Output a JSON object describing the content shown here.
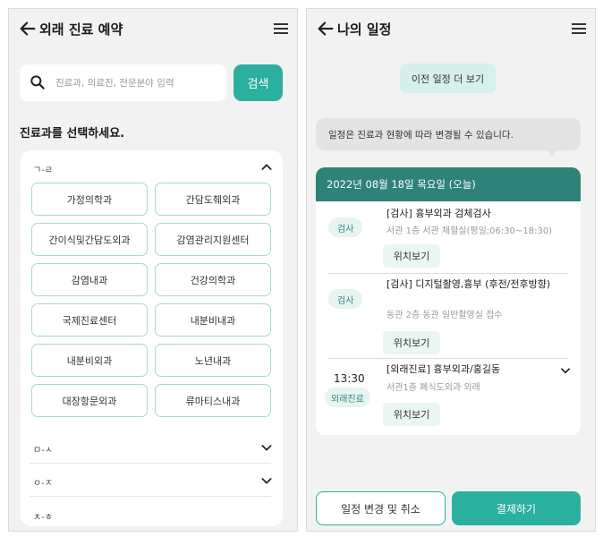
{
  "left_screen": {
    "header": {
      "title": "외래 진료 예약"
    },
    "search": {
      "placeholder": "진료과, 의료진, 전문분야 입력",
      "button_label": "검색"
    },
    "section_label": "진료과를 선택하세요.",
    "groups": [
      {
        "name": "ㄱ-ㄹ",
        "expanded": true,
        "departments": [
          "가정의학과",
          "간담도췌외과",
          "간이식및간담도외과",
          "감염관리지원센터",
          "감염내과",
          "건강의학과",
          "국제진료센터",
          "내분비내과",
          "내분비외과",
          "노년내과",
          "대장항문외과",
          "류마티스내과"
        ]
      },
      {
        "name": "ㅁ-ㅅ",
        "expanded": false
      },
      {
        "name": "ㅇ-ㅈ",
        "expanded": false
      },
      {
        "name": "ㅊ-ㅎ",
        "expanded": false
      }
    ]
  },
  "right_screen": {
    "header": {
      "title": "나의 일정"
    },
    "prev_button": "이전 일정 더 보기",
    "notice": "일정은 진료과 현황에 따라 변경될 수 있습니다.",
    "date_header": "2022년 08월 18일 목요일 (오늘)",
    "entries": [
      {
        "tag": "검사",
        "title": "[검사] 흉부외과 검체검사",
        "subtitle": "서관 1층 서관 채혈실(평일;06:30~18:30)",
        "location_button": "위치보기"
      },
      {
        "tag": "검사",
        "title": "[검사] 디지털촬영,흉부 (후전/전후방향)",
        "subtitle": "동관 2층 동관 일반촬영실 접수",
        "location_button": "위치보기"
      },
      {
        "time": "13:30",
        "tag": "외래진료",
        "title": "[외래진료] 흉부외과/홍길동",
        "subtitle": "서관1층 폐식도외과 외래",
        "location_button": "위치보기"
      }
    ],
    "buttons": {
      "change_cancel": "일정 변경 및 취소",
      "pay": "결제하기"
    }
  },
  "colors": {
    "accent": "#2bb0a0",
    "date_bar": "#2e8378",
    "tag_bg": "#e6f4f2"
  },
  "icons": [
    "back-arrow-icon",
    "hamburger-menu-icon",
    "search-icon",
    "chevron-up-icon",
    "chevron-down-icon"
  ]
}
